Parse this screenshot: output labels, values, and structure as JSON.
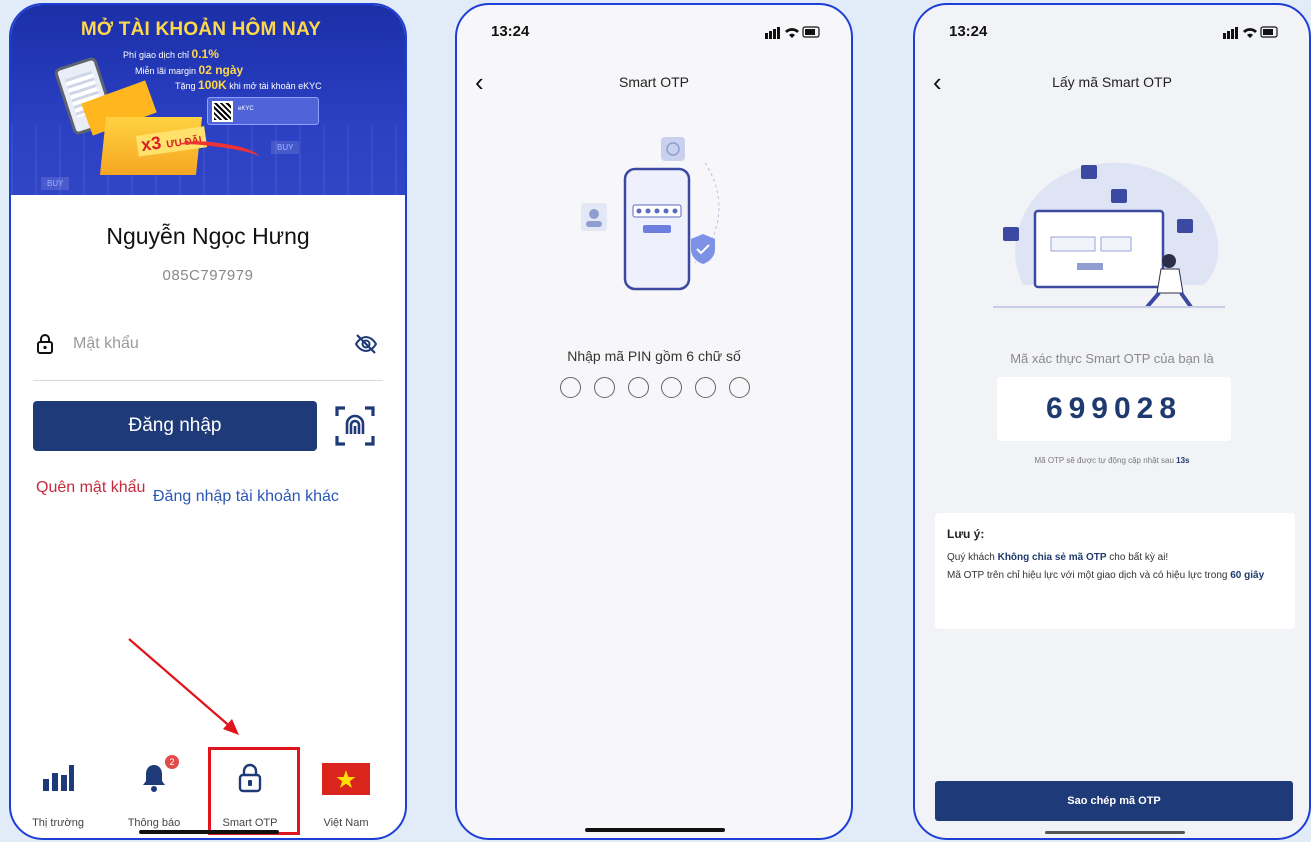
{
  "phone1": {
    "banner": {
      "title": "MỞ TÀI KHOẢN HÔM NAY",
      "line1_prefix": "Phí giao dịch chỉ ",
      "line1_value": "0.1%",
      "line2_prefix": "Miễn lãi margin ",
      "line2_value": "02 ngày",
      "line3_prefix": "Tặng ",
      "line3_value": "100K",
      "line3_suffix": " khi mở tài khoản eKYC",
      "qr_text": "eKYC",
      "promo_badge": "x3",
      "promo_badge_suffix": "ƯU ĐÃI",
      "buy_tag_1": "BUY",
      "buy_tag_2": "BUY"
    },
    "user_name": "Nguyễn Ngọc Hưng",
    "user_id": "085C797979",
    "password_placeholder": "Mật khẩu",
    "login_button": "Đăng nhập",
    "forgot_password": "Quên mật khẩu",
    "other_account": "Đăng nhập tài khoản khác",
    "tabs": [
      {
        "label": "Thị trường",
        "icon": "bar-chart-icon"
      },
      {
        "label": "Thông báo",
        "icon": "bell-icon",
        "badge": "2"
      },
      {
        "label": "Smart OTP",
        "icon": "lock-icon"
      },
      {
        "label": "Việt Nam",
        "icon": "vietnam-flag-icon"
      }
    ],
    "accent_color": "#1e3a78",
    "highlight_color": "#e0141d"
  },
  "phone2": {
    "time": "13:24",
    "title": "Smart OTP",
    "pin_label": "Nhập mã PIN gồm 6 chữ số",
    "pin_length": 6
  },
  "phone3": {
    "time": "13:24",
    "title": "Lấy mã Smart OTP",
    "otp_label": "Mã xác thực Smart OTP của bạn là",
    "otp_code": "699028",
    "refresh_prefix": "Mã OTP sẽ được tự động cập nhật sau ",
    "refresh_seconds": "13s",
    "note_title": "Lưu ý:",
    "note_line1_prefix": "Quý khách ",
    "note_line1_bold": "Không chia sẻ mã OTP",
    "note_line1_suffix": " cho bất kỳ ai!",
    "note_line2_prefix": "Mã OTP trên chỉ hiệu lực với một giao dịch và có hiệu lực trong ",
    "note_line2_bold": "60 giây",
    "copy_button": "Sao chép mã OTP"
  }
}
